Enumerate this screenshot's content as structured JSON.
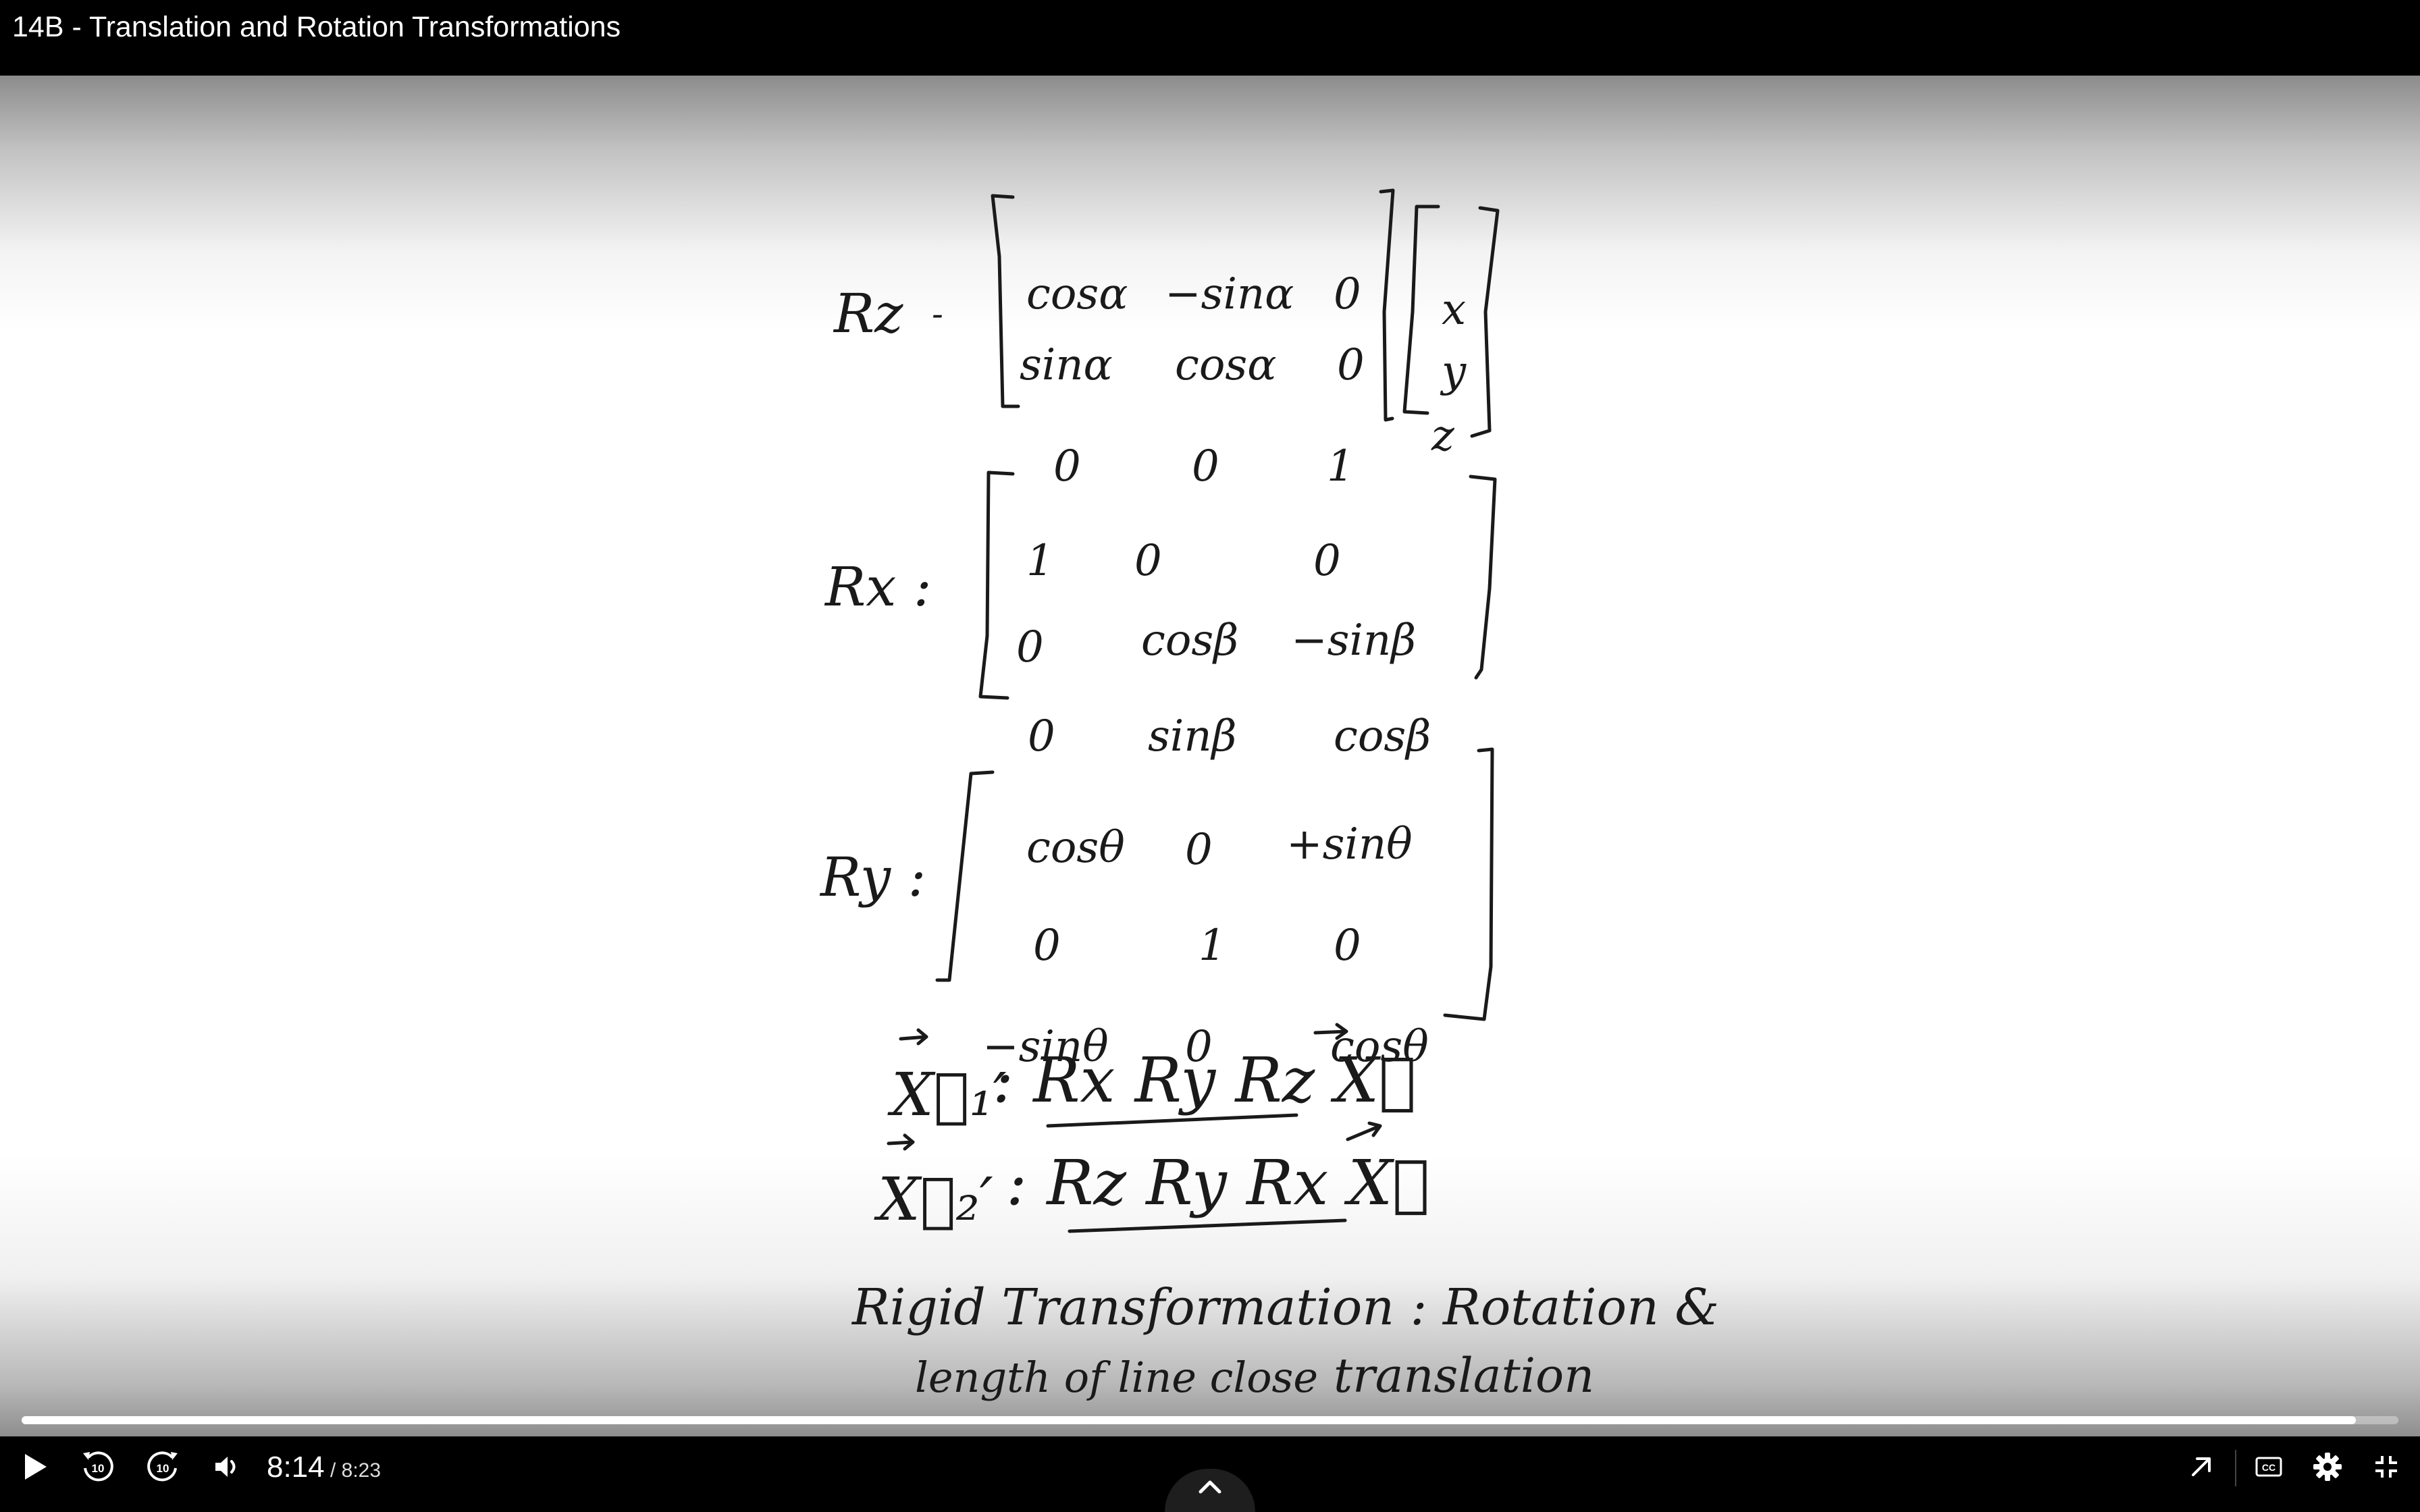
{
  "player": {
    "title": "14B - Translation and Rotation Transformations",
    "current_time": "8:14",
    "separator": " / ",
    "total_time": "8:23",
    "progress": 0.982,
    "colors": {
      "accent": "#ffffff",
      "track": "#5a5a5a",
      "bar": "#000000"
    }
  },
  "board": {
    "rz": {
      "label": "Rz",
      "row1": [
        "cosα",
        "−sinα",
        "0"
      ],
      "row2": [
        "sinα",
        "cosα",
        "0"
      ],
      "row3": [
        "0",
        "0",
        "1"
      ],
      "vector": [
        "x",
        "y",
        "z"
      ]
    },
    "rx": {
      "label": "Rx :",
      "row1": [
        "1",
        "0",
        "0"
      ],
      "row2": [
        "0",
        "cosβ",
        "−sinβ"
      ],
      "row3": [
        "0",
        "sinβ",
        "cosβ"
      ]
    },
    "ry": {
      "label": "Ry :",
      "row1": [
        "cosθ",
        "0",
        "+sinθ"
      ],
      "row2": [
        "0",
        "1",
        "0"
      ],
      "row3": [
        "−sinθ",
        "0",
        "cosθ"
      ]
    },
    "eq1": {
      "lhs": "X⃗₁′",
      "rhs": ": Rx Ry Rz X⃗"
    },
    "eq2": {
      "lhs": "X⃗₂′",
      "rhs": ": Rz Ry Rx X⃗"
    },
    "note1": "Rigid Transformation : Rotation &",
    "note2": "length of line close",
    "note3": "translation"
  },
  "icons": {
    "play": "play-icon",
    "rewind": "rewind-10-icon",
    "forward": "forward-10-icon",
    "volume": "volume-icon",
    "expand": "chevron-up-icon",
    "popout": "popout-arrow-icon",
    "captions": "closed-captions-icon",
    "settings": "gear-icon",
    "fullscreen": "exit-fullscreen-icon"
  }
}
